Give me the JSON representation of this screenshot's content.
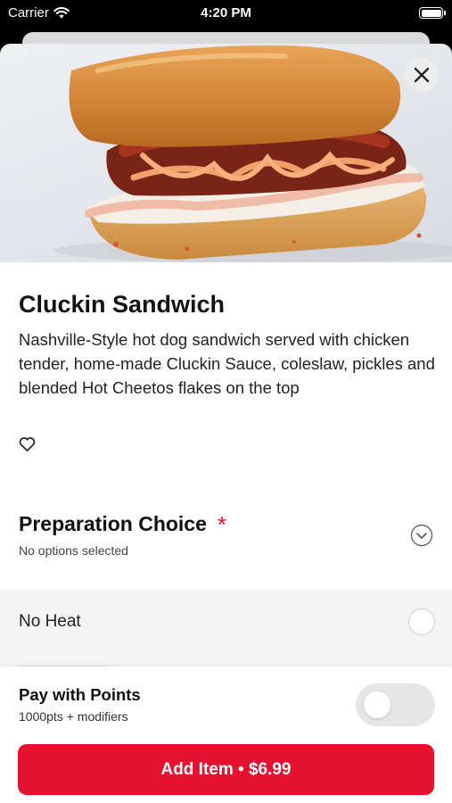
{
  "status_bar": {
    "carrier": "Carrier",
    "time": "4:20 PM"
  },
  "item": {
    "title": "Cluckin Sandwich",
    "description": "Nashville-Style hot dog sandwich served with chicken tender, home-made Cluckin Sauce, coleslaw, pickles and blended Hot Cheetos flakes on the top"
  },
  "modifier_group": {
    "title": "Preparation Choice",
    "required_marker": "*",
    "subtitle": "No options selected",
    "options": [
      {
        "label": "No Heat",
        "selected": false
      }
    ]
  },
  "points": {
    "title": "Pay with Points",
    "subtitle": "1000pts + modifiers",
    "enabled": false
  },
  "add_button": {
    "label": "Add Item • $6.99"
  },
  "colors": {
    "accent": "#e6102f",
    "required": "#e0103a"
  },
  "icons": {
    "close": "close-icon",
    "favorite": "heart-icon",
    "expand": "chevron-down-icon"
  }
}
